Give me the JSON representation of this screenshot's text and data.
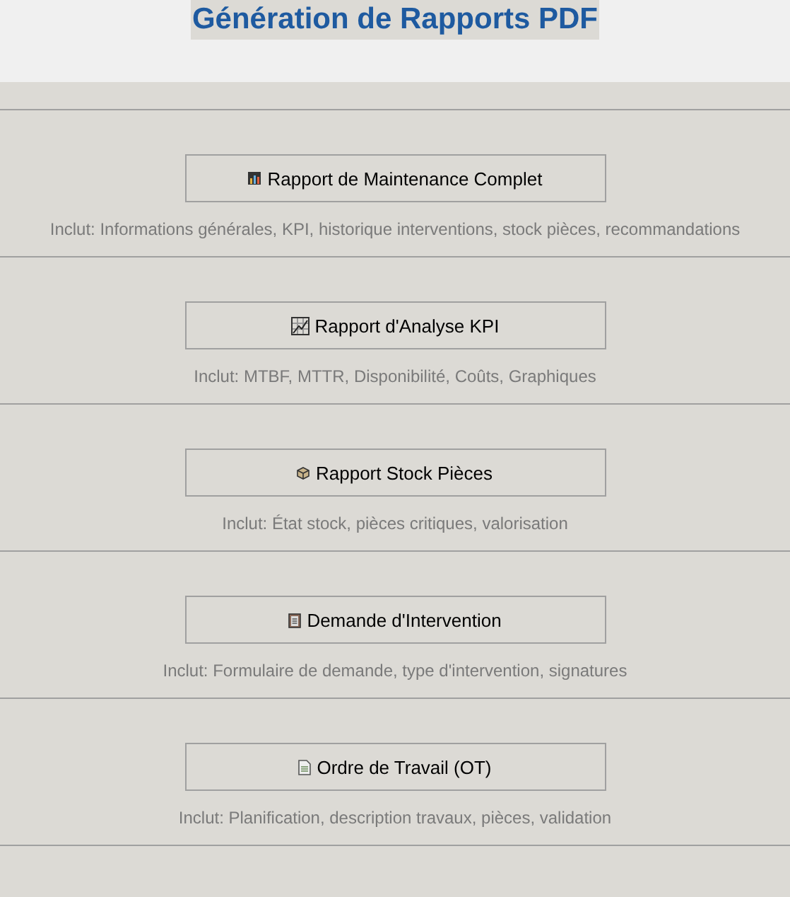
{
  "title": "Génération de Rapports PDF",
  "reports": [
    {
      "kind": "bar-chart",
      "label": "Rapport de Maintenance Complet",
      "description": "Inclut: Informations générales, KPI, historique interventions, stock pièces, recommandations"
    },
    {
      "kind": "line-chart",
      "label": "Rapport d'Analyse KPI",
      "description": "Inclut: MTBF, MTTR, Disponibilité, Coûts, Graphiques"
    },
    {
      "kind": "box",
      "label": "Rapport Stock Pièces",
      "description": "Inclut: État stock, pièces critiques, valorisation"
    },
    {
      "kind": "clipboard",
      "label": "Demande d'Intervention",
      "description": "Inclut: Formulaire de demande, type d'intervention, signatures"
    },
    {
      "kind": "document",
      "label": "Ordre de Travail (OT)",
      "description": "Inclut: Planification, description travaux, pièces, validation"
    }
  ]
}
